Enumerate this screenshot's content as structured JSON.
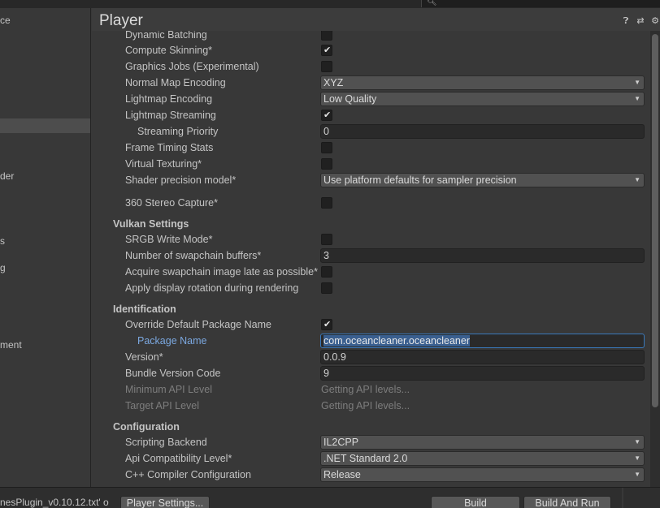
{
  "search": {
    "icon": "search-icon"
  },
  "sidebar": {
    "items": [
      {
        "label": "ce",
        "selected": false
      },
      {
        "label": "",
        "selected": true
      },
      {
        "label": "der",
        "selected": false
      },
      {
        "label": "s",
        "selected": false
      },
      {
        "label": "g",
        "selected": false
      },
      {
        "label": "ment",
        "selected": false
      }
    ]
  },
  "header": {
    "title": "Player",
    "icons": [
      "help-icon",
      "presets-icon",
      "settings-gear-icon"
    ]
  },
  "rows": {
    "dynamic_batching": {
      "label": "Dynamic Batching",
      "checked": false
    },
    "compute_skinning": {
      "label": "Compute Skinning*",
      "checked": true
    },
    "graphics_jobs": {
      "label": "Graphics Jobs (Experimental)",
      "checked": false
    },
    "normal_map_encoding": {
      "label": "Normal Map Encoding",
      "value": "XYZ"
    },
    "lightmap_encoding": {
      "label": "Lightmap Encoding",
      "value": "Low Quality"
    },
    "lightmap_streaming": {
      "label": "Lightmap Streaming",
      "checked": true
    },
    "streaming_priority": {
      "label": "Streaming Priority",
      "value": "0"
    },
    "frame_timing_stats": {
      "label": "Frame Timing Stats",
      "checked": false
    },
    "virtual_texturing": {
      "label": "Virtual Texturing*",
      "checked": false
    },
    "shader_precision": {
      "label": "Shader precision model*",
      "value": "Use platform defaults for sampler precision"
    },
    "stereo_capture": {
      "label": "360 Stereo Capture*",
      "checked": false
    },
    "vulkan_header": "Vulkan Settings",
    "srgb_write": {
      "label": "SRGB Write Mode*",
      "checked": false
    },
    "swapchain_buffers": {
      "label": "Number of swapchain buffers*",
      "value": "3"
    },
    "acquire_late": {
      "label": "Acquire swapchain image late as possible*",
      "checked": false
    },
    "display_rotation": {
      "label": "Apply display rotation during rendering",
      "checked": false
    },
    "identification_header": "Identification",
    "override_package": {
      "label": "Override Default Package Name",
      "checked": true
    },
    "package_name": {
      "label": "Package Name",
      "value": "com.oceancleaner.oceancleaner"
    },
    "version": {
      "label": "Version*",
      "value": "0.0.9"
    },
    "bundle_version_code": {
      "label": "Bundle Version Code",
      "value": "9"
    },
    "min_api": {
      "label": "Minimum API Level",
      "value": "Getting API levels..."
    },
    "target_api": {
      "label": "Target API Level",
      "value": "Getting API levels..."
    },
    "configuration_header": "Configuration",
    "scripting_backend": {
      "label": "Scripting Backend",
      "value": "IL2CPP"
    },
    "api_compat": {
      "label": "Api Compatibility Level*",
      "value": ".NET Standard 2.0"
    },
    "cpp_compiler": {
      "label": "C++ Compiler Configuration",
      "value": "Release"
    }
  },
  "bottom": {
    "log_text": "nesPlugin_v0.10.12.txt' o",
    "player_settings": "Player Settings...",
    "build": "Build",
    "build_and_run": "Build And Run"
  },
  "colors": {
    "background": "#383838",
    "selection_accent": "#3a79bb",
    "link_label": "#7ba8e0"
  }
}
